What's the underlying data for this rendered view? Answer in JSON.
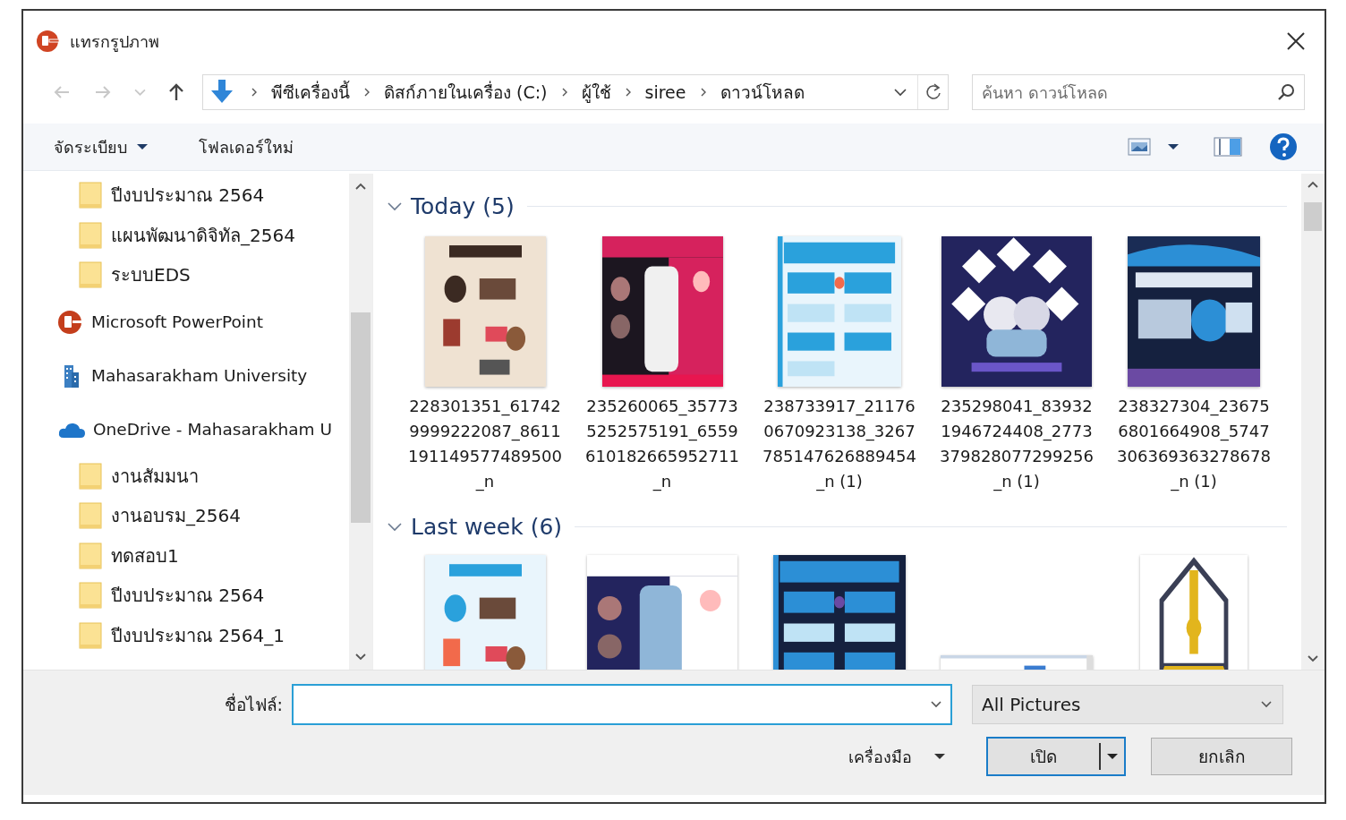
{
  "window": {
    "title": "แทรกรูปภาพ"
  },
  "nav": {
    "buttons": [
      {
        "kind": "back",
        "disabled": true
      },
      {
        "kind": "forward",
        "disabled": true
      },
      {
        "kind": "recent",
        "disabled": true
      },
      {
        "kind": "up",
        "disabled": false
      }
    ],
    "breadcrumb": [
      "พีซีเครื่องนี้",
      "ดิสก์ภายในเครื่อง (C:)",
      "ผู้ใช้",
      "siree",
      "ดาวน์โหลด"
    ],
    "search": {
      "placeholder": "ค้นหา ดาวน์โหลด"
    }
  },
  "toolbar": {
    "organize": "จัดระเบียบ",
    "new_folder": "โฟลเดอร์ใหม่"
  },
  "sidebar": {
    "items": [
      {
        "kind": "folder",
        "label": "ปีงบประมาณ 2564"
      },
      {
        "kind": "folder",
        "label": "แผนพัฒนาดิจิทัล_2564"
      },
      {
        "kind": "folder",
        "label": "ระบบEDS"
      },
      {
        "kind": "app",
        "label": "Microsoft PowerPoint"
      },
      {
        "kind": "organization",
        "label": "Mahasarakham University"
      },
      {
        "kind": "cloud",
        "label": "OneDrive - Mahasarakham U",
        "children": [
          {
            "kind": "folder",
            "label": "งานสัมมนา"
          },
          {
            "kind": "folder",
            "label": "งานอบรม_2564"
          },
          {
            "kind": "folder",
            "label": "ทดสอบ1"
          },
          {
            "kind": "folder",
            "label": "ปีงบประมาณ 2564"
          },
          {
            "kind": "folder",
            "label": "ปีงบประมาณ 2564_1"
          }
        ]
      }
    ]
  },
  "content": {
    "groups": [
      {
        "label": "Today (5)",
        "expanded": true,
        "items": [
          {
            "kind": "picture",
            "name": "228301351_617429999222087_8611191149577489500_n"
          },
          {
            "kind": "picture",
            "name": "235260065_357735252575191_6559610182665952711_n"
          },
          {
            "kind": "picture",
            "name": "238733917_211760670923138_3267785147626889454_n (1)"
          },
          {
            "kind": "picture",
            "name": "235298041_839321946724408_2773379828077299256_n (1)"
          },
          {
            "kind": "picture",
            "name": "238327304_236756801664908_5747306369363278678_n (1)"
          }
        ]
      },
      {
        "label": "Last week (6)",
        "expanded": true
      }
    ]
  },
  "footer": {
    "filename_label": "ชื่อไฟล์:",
    "file_type": "All Pictures",
    "tools": "เครื่องมือ",
    "open": "เปิด",
    "cancel": "ยกเลิก"
  }
}
